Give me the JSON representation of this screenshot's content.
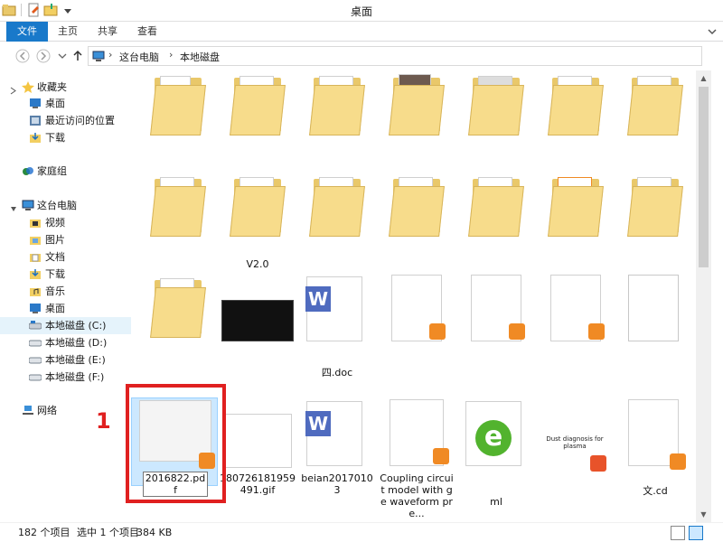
{
  "window": {
    "title": "桌面"
  },
  "ribbon": {
    "tabs": [
      "文件",
      "主页",
      "共享",
      "查看"
    ]
  },
  "address": {
    "crumbs": [
      "这台电脑",
      "本地磁盘"
    ]
  },
  "sidebar": {
    "items": [
      {
        "label": "收藏夹",
        "icon": "star-icon"
      },
      {
        "label": "桌面",
        "icon": "desktop-icon"
      },
      {
        "label": "最近访问的位置",
        "icon": "recent-icon"
      },
      {
        "label": "下载",
        "icon": "download-folder-icon"
      },
      {
        "label": "家庭组",
        "icon": "homegroup-icon"
      },
      {
        "label": "这台电脑",
        "icon": "computer-icon"
      },
      {
        "label": "视频",
        "icon": "video-folder-icon"
      },
      {
        "label": "图片",
        "icon": "pictures-folder-icon"
      },
      {
        "label": "文档",
        "icon": "documents-folder-icon"
      },
      {
        "label": "下载",
        "icon": "download-folder-icon"
      },
      {
        "label": "音乐",
        "icon": "music-folder-icon"
      },
      {
        "label": "桌面",
        "icon": "desktop-icon"
      },
      {
        "label": "本地磁盘 (C:)",
        "icon": "drive-c-icon"
      },
      {
        "label": "本地磁盘 (D:)",
        "icon": "drive-icon"
      },
      {
        "label": "本地磁盘 (E:)",
        "icon": "drive-icon"
      },
      {
        "label": "本地磁盘 (F:)",
        "icon": "drive-icon"
      },
      {
        "label": "网络",
        "icon": "network-icon"
      }
    ]
  },
  "files": {
    "row2_labels": [
      "V2.0"
    ],
    "row3_labels": [
      "四.doc"
    ],
    "row4": [
      {
        "label": "2016822.pdf"
      },
      {
        "label": "180726181959491.gif"
      },
      {
        "label": "beian20170103"
      },
      {
        "label": "Coupling circuit model with ge waveform pre..."
      },
      {
        "label": "ml"
      },
      {
        "label": "Dust diagnosis for plasma"
      },
      {
        "label": "文.cd"
      }
    ],
    "folder_badge_pdf": "pdf",
    "doc_letter": "W",
    "ie_letter": "e"
  },
  "annotation": {
    "number": "1"
  },
  "status": {
    "item_count": "182 个项目",
    "selected": "选中 1 个项目",
    "size": "384 KB"
  },
  "colors": {
    "accent": "#1979ca",
    "selection": "#cce8ff",
    "selection_border": "#99d1ff",
    "folder": "#f7dc8b",
    "wps_orange": "#f08a24",
    "wps_blue": "#4f6bbf",
    "annotation_red": "#e02020"
  }
}
